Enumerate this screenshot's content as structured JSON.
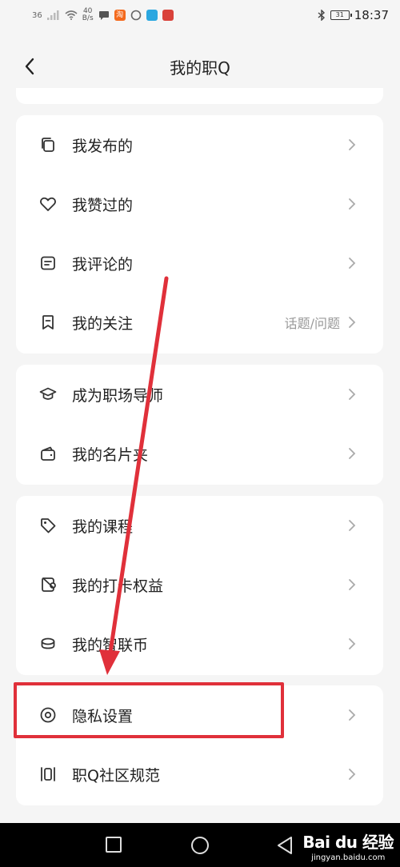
{
  "status_bar": {
    "signal": "36",
    "speed_top": "40",
    "speed_bottom": "B/s",
    "app_icon_taobao": "淘",
    "battery": "31",
    "time": "18:37"
  },
  "header": {
    "title": "我的职Q",
    "back_icon": "chevron-left-icon"
  },
  "groups": [
    {
      "items": [
        {
          "label": "我发布的",
          "icon": "copy-icon",
          "extra": ""
        },
        {
          "label": "我赞过的",
          "icon": "heart-icon",
          "extra": ""
        },
        {
          "label": "我评论的",
          "icon": "comment-icon",
          "extra": ""
        },
        {
          "label": "我的关注",
          "icon": "bookmark-icon",
          "extra": "话题/问题"
        }
      ]
    },
    {
      "items": [
        {
          "label": "成为职场导师",
          "icon": "graduation-cap-icon",
          "extra": ""
        },
        {
          "label": "我的名片夹",
          "icon": "wallet-icon",
          "extra": ""
        }
      ]
    },
    {
      "items": [
        {
          "label": "我的课程",
          "icon": "tag-icon",
          "extra": ""
        },
        {
          "label": "我的打卡权益",
          "icon": "card-icon",
          "extra": ""
        },
        {
          "label": "我的智联币",
          "icon": "coin-stack-icon",
          "extra": ""
        }
      ]
    },
    {
      "items": [
        {
          "label": "隐私设置",
          "icon": "privacy-icon",
          "extra": ""
        },
        {
          "label": "职Q社区规范",
          "icon": "rules-icon",
          "extra": ""
        }
      ]
    }
  ],
  "annotation": {
    "color": "#e0303a"
  },
  "watermark": {
    "brand": "Bai du 经验",
    "url": "jingyan.baidu.com"
  }
}
